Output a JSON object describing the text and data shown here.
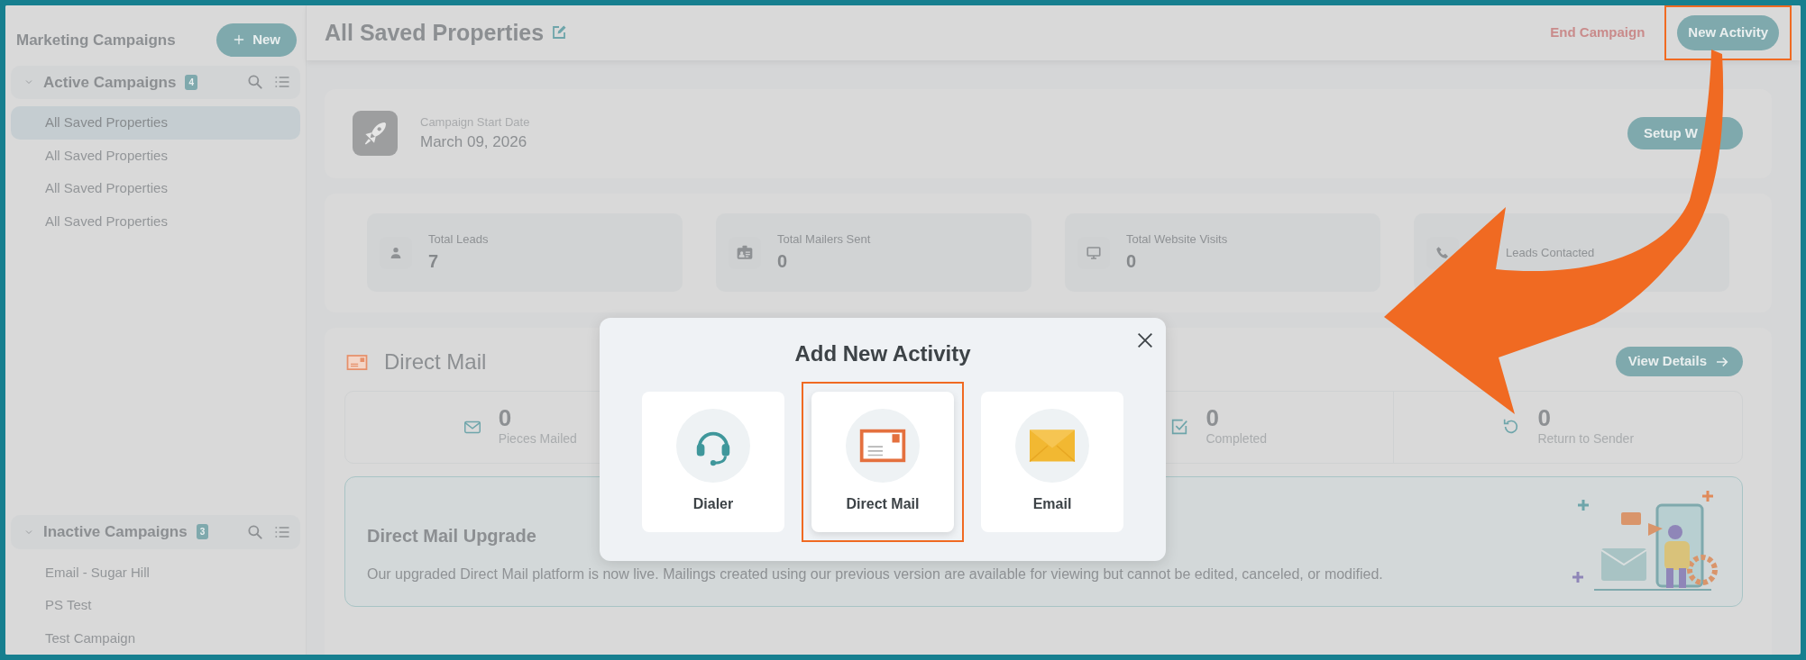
{
  "sidebar": {
    "title": "Marketing Campaigns",
    "new_button": "New",
    "groups": [
      {
        "title": "Active Campaigns",
        "count": "4",
        "expanded": true,
        "items": [
          {
            "label": "All Saved Properties",
            "selected": true
          },
          {
            "label": "All Saved Properties",
            "selected": false
          },
          {
            "label": "All Saved Properties",
            "selected": false
          },
          {
            "label": "All Saved Properties",
            "selected": false
          }
        ]
      },
      {
        "title": "Inactive Campaigns",
        "count": "3",
        "expanded": true,
        "items": [
          {
            "label": "Email - Sugar Hill",
            "selected": false
          },
          {
            "label": "PS Test",
            "selected": false
          },
          {
            "label": "Test Campaign",
            "selected": false
          }
        ]
      }
    ]
  },
  "header": {
    "title": "All Saved Properties",
    "end_button": "End Campaign",
    "new_activity_button": "New Activity",
    "new_activity_highlighted": true
  },
  "campaign_card": {
    "date_label": "Campaign Start Date",
    "date": "March 09, 2026",
    "setup_button": "Setup W"
  },
  "stats": [
    {
      "kind": "person",
      "label": "Total Leads",
      "value": "7"
    },
    {
      "kind": "id-card",
      "label": "Total Mailers Sent",
      "value": "0"
    },
    {
      "kind": "monitor",
      "label": "Total Website Visits",
      "value": "0"
    },
    {
      "kind": "phone",
      "label": "Leads Contacted"
    }
  ],
  "direct_mail": {
    "title": "Direct Mail",
    "details_button": "View Details",
    "metrics": [
      {
        "kind": "envelope",
        "value": "0",
        "label": "Pieces Mailed"
      },
      {
        "kind": "hidden"
      },
      {
        "kind": "check",
        "value": "0",
        "label": "Completed"
      },
      {
        "kind": "return",
        "value": "0",
        "label": "Return to Sender"
      }
    ],
    "upgrade": {
      "title": "Direct Mail Upgrade",
      "text": "Our upgraded Direct Mail platform is now live. Mailings created using our previous version are available for viewing but cannot be edited, canceled, or modified."
    }
  },
  "modal": {
    "title": "Add New Activity",
    "options": [
      {
        "kind": "dialer",
        "label": "Dialer",
        "selected": false
      },
      {
        "kind": "mail",
        "label": "Direct Mail",
        "selected": true
      },
      {
        "kind": "email",
        "label": "Email",
        "selected": false
      }
    ]
  }
}
